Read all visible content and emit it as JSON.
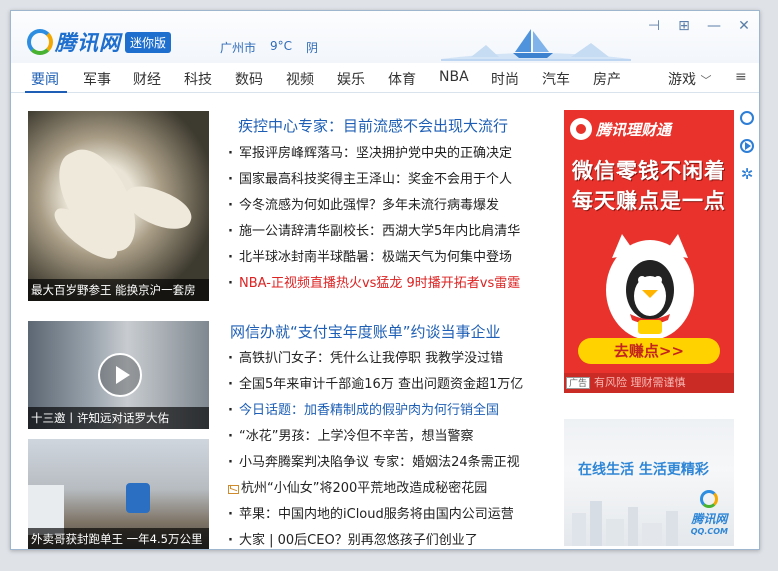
{
  "window": {
    "logo_text": "腾讯网",
    "logo_badge": "迷你版",
    "controls": [
      {
        "name": "pin-icon",
        "glyph": "⊣"
      },
      {
        "name": "restore-icon",
        "glyph": "⊞"
      },
      {
        "name": "minimize-icon",
        "glyph": "—"
      },
      {
        "name": "close-icon",
        "glyph": "✕"
      }
    ]
  },
  "weather": {
    "city": "广州市",
    "temperature": "9°C",
    "condition": "阴"
  },
  "nav": {
    "items": [
      "要闻",
      "军事",
      "财经",
      "科技",
      "数码",
      "视频",
      "娱乐",
      "体育",
      "NBA",
      "时尚",
      "汽车",
      "房产"
    ],
    "active": "要闻",
    "more_label": "游戏",
    "more_icon": "chevron-down-icon",
    "menu_icon": "hamburger-menu-icon"
  },
  "thumbs": [
    {
      "caption": "最大百岁野参王 能换京沪一套房"
    },
    {
      "caption": "十三邀丨许知远对话罗大佑"
    },
    {
      "caption": "外卖哥获封跑单王 一年4.5万公里"
    }
  ],
  "news": {
    "headline1": "疾控中心专家：目前流感不会出现大流行",
    "group1": [
      {
        "text": "军报评房峰辉落马：坚决拥护党中央的正确决定",
        "style": "normal"
      },
      {
        "text": "国家最高科技奖得主王泽山：奖金不会用于个人",
        "style": "normal"
      },
      {
        "text": "今冬流感为何如此强悍？多年未流行病毒爆发",
        "style": "normal"
      },
      {
        "text": "施一公请辞清华副校长：西湖大学5年内比肩清华",
        "style": "normal"
      },
      {
        "text": "北半球冰封南半球酷暑：极端天气为何集中登场",
        "style": "normal"
      },
      {
        "text": "NBA-正视频直播热火vs猛龙 9时播开拓者vs雷霆",
        "style": "red"
      }
    ],
    "headline2": "网信办就“支付宝年度账单”约谈当事企业",
    "group2": [
      {
        "text": "高铁扒门女子：凭什么让我停职 我教学没过错",
        "style": "normal"
      },
      {
        "text": "全国5年来审计千部逾16万 查出问题资金超1万亿",
        "style": "normal"
      },
      {
        "text": "今日话题：加香精制成的假驴肉为何行销全国",
        "style": "blue"
      },
      {
        "text": "“冰花”男孩：上学冷但不辛苦，想当警察",
        "style": "normal"
      },
      {
        "text": "小马奔腾案判决陷争议 专家：婚姻法24条需正视",
        "style": "normal"
      },
      {
        "text": "杭州“小仙女”将200平荒地改造成秘密花园",
        "style": "mail"
      },
      {
        "text": "苹果：中国内地的iCloud服务将由国内公司运营",
        "style": "normal"
      },
      {
        "text": "大家 | 00后CEO？别再忽悠孩子们创业了",
        "style": "normal"
      }
    ]
  },
  "ad_finance": {
    "brand": "腾讯理财通",
    "line1": "微信零钱不闲着",
    "line2": "每天赚点是一点",
    "button": "去赚点>>",
    "tag": "广告",
    "footer": "有风险 理财需谨慎"
  },
  "ad_life": {
    "slogan": "在线生活 生活更精彩",
    "logo": "腾讯网",
    "logo_sub": "QQ.COM"
  },
  "side_icons": [
    "refresh-icon",
    "play-icon",
    "settings-icon"
  ]
}
